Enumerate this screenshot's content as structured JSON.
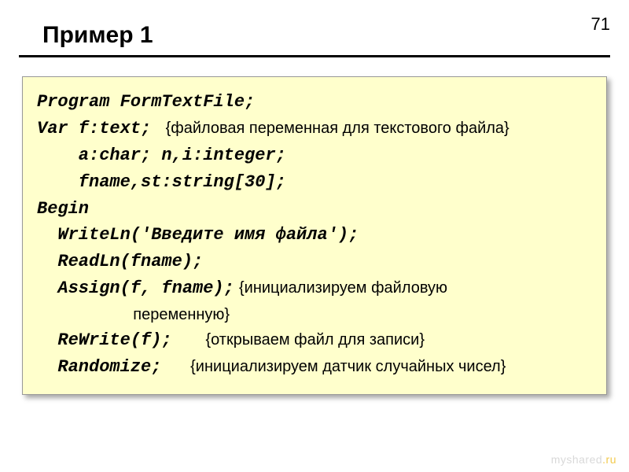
{
  "slide_number": "71",
  "title": "Пример 1",
  "code": {
    "l1": "Program FormTextFile;",
    "l2a": "Var f:text;",
    "l2c": "{файловая переменная для текстового файла}",
    "l3": "    a:char; n,i:integer;",
    "l4": "    fname,st:string[30];",
    "l5": "Begin",
    "l6": "  WriteLn('Введите имя файла');",
    "l7": "  ReadLn(fname);",
    "l8a": "  Assign(f, fname);",
    "l8c": "{инициализируем файловую",
    "l8c2": "                      переменную}",
    "l9a": "  ReWrite(f);",
    "l9c": "{открываем файл для записи}",
    "l10a": "  Randomize;",
    "l10c": "{инициализируем датчик случайных чисел}"
  },
  "watermark": {
    "text": "myshared",
    "suffix": ".ru"
  }
}
